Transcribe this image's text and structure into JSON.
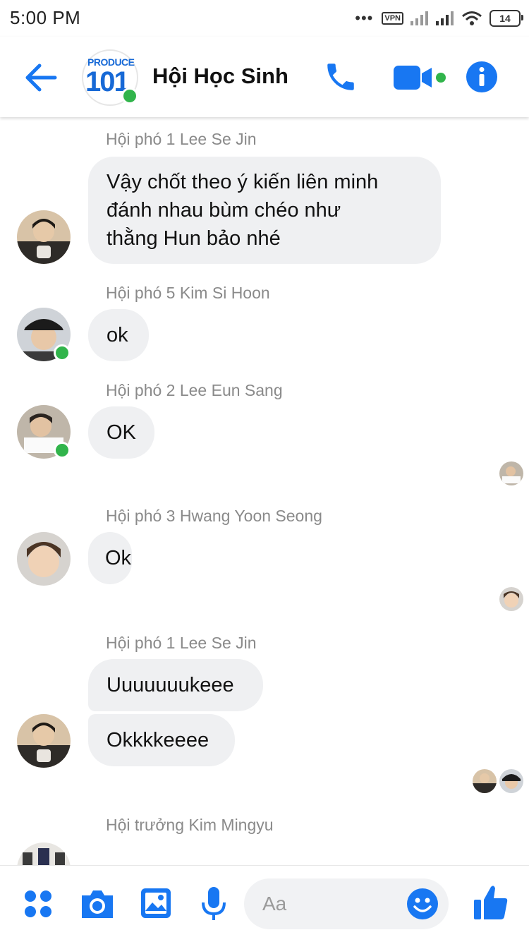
{
  "status_bar": {
    "time": "5:00 PM",
    "dots": "•••",
    "vpn": "VPN",
    "battery": "14"
  },
  "header": {
    "title": "Hội Học Sinh",
    "group_logo_top": "PRODUCE",
    "group_logo_main": "101",
    "accent_color": "#1877f2"
  },
  "messages": [
    {
      "sender": "Hội phó 1 Lee Se Jin",
      "lines": [
        "Vậy chốt theo ý kiến liên minh",
        "đánh nhau bùm chéo như",
        "thằng Hun bảo nhé"
      ]
    },
    {
      "sender": "Hội phó 5 Kim Si Hoon",
      "text": "ok"
    },
    {
      "sender": "Hội phó 2 Lee Eun Sang",
      "text": "OK"
    },
    {
      "sender": "Hội phó 3 Hwang Yoon Seong",
      "text": "Ok"
    },
    {
      "sender": "Hội phó 1 Lee Se Jin",
      "texts": [
        "Uuuuuuukeee",
        "Okkkkeeee"
      ]
    },
    {
      "sender": "Hội trưởng Kim Mingyu"
    }
  ],
  "composer": {
    "placeholder": "Aa"
  }
}
